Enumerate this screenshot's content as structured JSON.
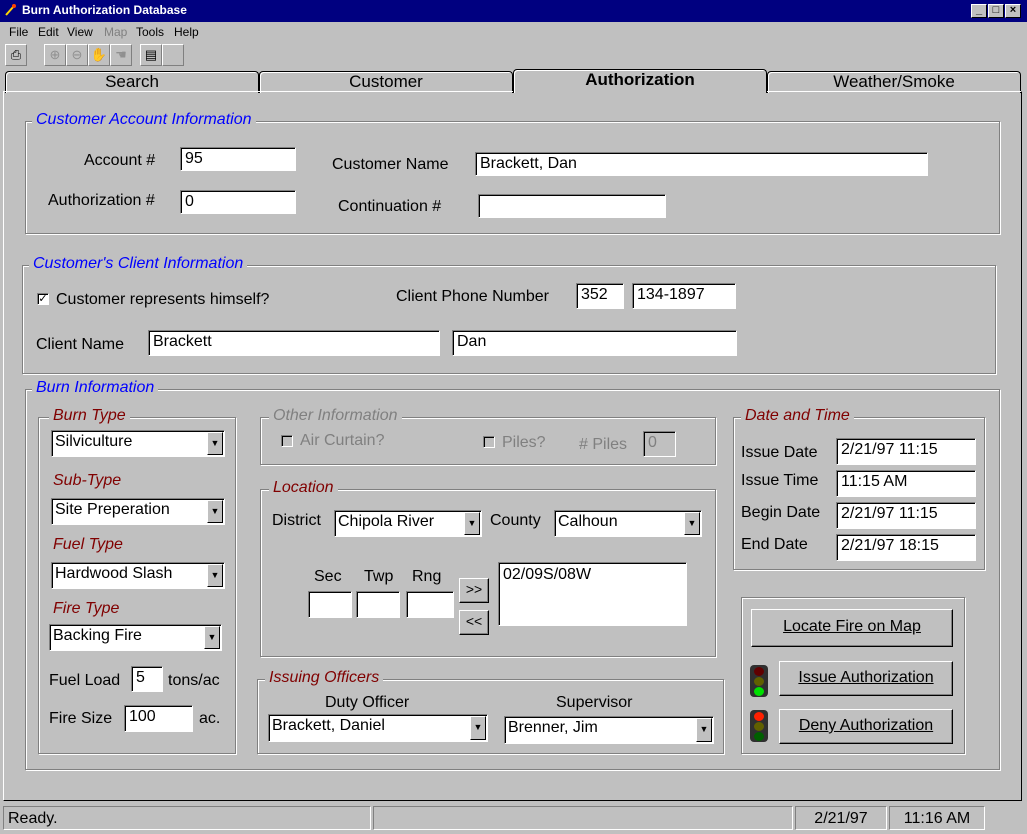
{
  "window": {
    "title": "Burn Authorization Database",
    "controls": [
      "_",
      "□",
      "×"
    ]
  },
  "menu": [
    {
      "label": "File",
      "enabled": true
    },
    {
      "label": "Edit",
      "enabled": true
    },
    {
      "label": "View",
      "enabled": true
    },
    {
      "label": "Map",
      "enabled": false
    },
    {
      "label": "Tools",
      "enabled": true
    },
    {
      "label": "Help",
      "enabled": true
    }
  ],
  "toolbar": {
    "icons": [
      "printer-icon",
      "zoom-in-icon",
      "zoom-out-icon",
      "pan-hand-icon",
      "hand-icon",
      "notebook-icon"
    ]
  },
  "tabs": [
    {
      "label": "Search",
      "active": false
    },
    {
      "label": "Customer",
      "active": false
    },
    {
      "label": "Authorization",
      "active": true
    },
    {
      "label": "Weather/Smoke",
      "active": false
    }
  ],
  "account": {
    "title": "Customer Account Information",
    "account_label": "Account #",
    "account_value": "95",
    "auth_label": "Authorization #",
    "auth_value": "0",
    "name_label": "Customer Name",
    "name_value": "Brackett, Dan",
    "cont_label": "Continuation #",
    "cont_value": ""
  },
  "client": {
    "title": "Customer's Client Information",
    "represents_label": "Customer represents himself?",
    "represents_checked": true,
    "phone_label": "Client Phone Number",
    "phone_area": "352",
    "phone_number": "134-1897",
    "name_label": "Client Name",
    "last_name": "Brackett",
    "first_name": "Dan"
  },
  "burn": {
    "title": "Burn Information",
    "burn_type_label": "Burn Type",
    "burn_type": "Silviculture",
    "sub_type_label": "Sub-Type",
    "sub_type": "Site Preperation",
    "fuel_type_label": "Fuel Type",
    "fuel_type": "Hardwood Slash",
    "fire_type_label": "Fire Type",
    "fire_type": "Backing Fire",
    "fuel_load_label": "Fuel Load",
    "fuel_load": "5",
    "fuel_load_unit": "tons/ac",
    "fire_size_label": "Fire Size",
    "fire_size": "100",
    "fire_size_unit": "ac."
  },
  "other": {
    "title": "Other Information",
    "air_curtain_label": "Air Curtain?",
    "piles_label": "Piles?",
    "num_piles_label": "# Piles",
    "num_piles": "0"
  },
  "location": {
    "title": "Location",
    "district_label": "District",
    "district": "Chipola River",
    "county_label": "County",
    "county": "Calhoun",
    "sec_label": "Sec",
    "twp_label": "Twp",
    "rng_label": "Rng",
    "add_label": ">>",
    "remove_label": "<<",
    "list": [
      "02/09S/08W"
    ]
  },
  "officers": {
    "title": "Issuing Officers",
    "duty_label": "Duty Officer",
    "duty": "Brackett, Daniel",
    "supervisor_label": "Supervisor",
    "supervisor": "Brenner, Jim"
  },
  "datetime": {
    "title": "Date and Time",
    "issue_date_label": "Issue Date",
    "issue_date": "2/21/97 11:15",
    "issue_time_label": "Issue Time",
    "issue_time": "11:15 AM",
    "begin_date_label": "Begin Date",
    "begin_date": "2/21/97 11:15",
    "end_date_label": "End Date",
    "end_date": "2/21/97 18:15"
  },
  "actions": {
    "locate": "Locate Fire on Map",
    "issue": "Issue Authorization",
    "deny": "Deny Authorization"
  },
  "status": {
    "message": "Ready.",
    "date": "2/21/97",
    "time": "11:16 AM"
  },
  "colors": {
    "title_bar": "#000080",
    "face": "#c0c0c0",
    "group_title_blue": "#0000ff",
    "group_title_red": "#800000"
  }
}
